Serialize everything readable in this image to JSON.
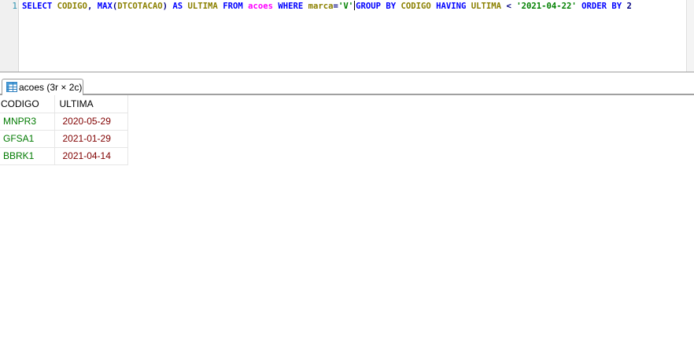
{
  "editor": {
    "line_number": "1",
    "tokens": [
      {
        "text": "SELECT ",
        "kind": "kw"
      },
      {
        "text": "CODIGO",
        "kind": "id"
      },
      {
        "text": ", ",
        "kind": "op"
      },
      {
        "text": "MAX",
        "kind": "kw"
      },
      {
        "text": "(",
        "kind": "op"
      },
      {
        "text": "DTCOTACAO",
        "kind": "id"
      },
      {
        "text": ") ",
        "kind": "op"
      },
      {
        "text": "AS ",
        "kind": "kw"
      },
      {
        "text": "ULTIMA ",
        "kind": "id"
      },
      {
        "text": "FROM ",
        "kind": "kw"
      },
      {
        "text": "acoes ",
        "kind": "tb"
      },
      {
        "text": "WHERE ",
        "kind": "kw"
      },
      {
        "text": "marca",
        "kind": "id"
      },
      {
        "text": "=",
        "kind": "op"
      },
      {
        "text": "'V'",
        "kind": "str"
      },
      {
        "text": "",
        "kind": "caret"
      },
      {
        "text": "GROUP BY ",
        "kind": "kw"
      },
      {
        "text": "CODIGO ",
        "kind": "id"
      },
      {
        "text": "HAVING ",
        "kind": "kw"
      },
      {
        "text": "ULTIMA ",
        "kind": "id"
      },
      {
        "text": "< ",
        "kind": "op"
      },
      {
        "text": "'2021-04-22' ",
        "kind": "str"
      },
      {
        "text": "ORDER BY ",
        "kind": "kw"
      },
      {
        "text": "2",
        "kind": "op"
      }
    ]
  },
  "result_tab": {
    "icon": "table-grid-icon",
    "label": "acoes (3r × 2c)"
  },
  "grid": {
    "columns": [
      "CODIGO",
      "ULTIMA"
    ],
    "rows": [
      [
        "MNPR3",
        "2020-05-29"
      ],
      [
        "GFSA1",
        "2021-01-29"
      ],
      [
        "BBRK1",
        "2021-04-14"
      ]
    ]
  },
  "colors": {
    "keyword": "#0000ff",
    "identifier": "#8b8000",
    "table": "#ff00ff",
    "string": "#008000",
    "cell_text": "#007a00",
    "date_text": "#800000"
  }
}
